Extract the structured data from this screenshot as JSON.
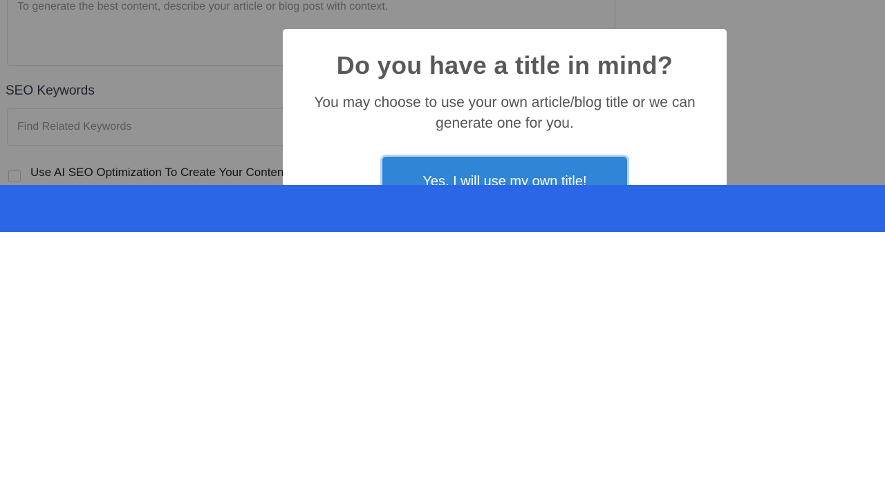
{
  "background_form": {
    "context_placeholder": "To generate the best content, describe your article or blog post with context.",
    "seo_keywords_label": "SEO Keywords",
    "keyword_placeholder": "Find Related Keywords",
    "seo_optimization_label": "Use AI SEO Optimization To Create Your Content"
  },
  "modal": {
    "title": "Do you have a title in mind?",
    "text": "You may choose to use your own article/blog title or we can generate one for you.",
    "confirm_label": "Yes, I will use my own title!"
  },
  "colors": {
    "banner": "#2b66e6",
    "confirm_button": "#3085d6",
    "overlay": "rgba(0,0,0,0.42)"
  }
}
